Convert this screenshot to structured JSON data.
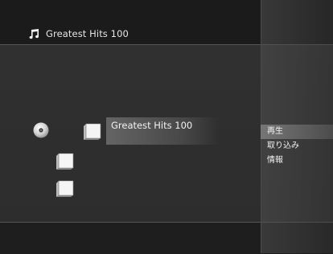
{
  "header": {
    "title": "Greatest Hits 100",
    "icon": "music-note-icon"
  },
  "content": {
    "album_title": "Greatest Hits 100",
    "disc_icon": "disc-icon",
    "folder_icon": "cube-icon"
  },
  "options_menu": {
    "items": [
      {
        "label": "再生"
      },
      {
        "label": "取り込み"
      },
      {
        "label": "情報"
      }
    ]
  },
  "colors": {
    "background": "#2c2c2c",
    "bar": "#1b1b1b",
    "text": "#f0f0f0"
  }
}
